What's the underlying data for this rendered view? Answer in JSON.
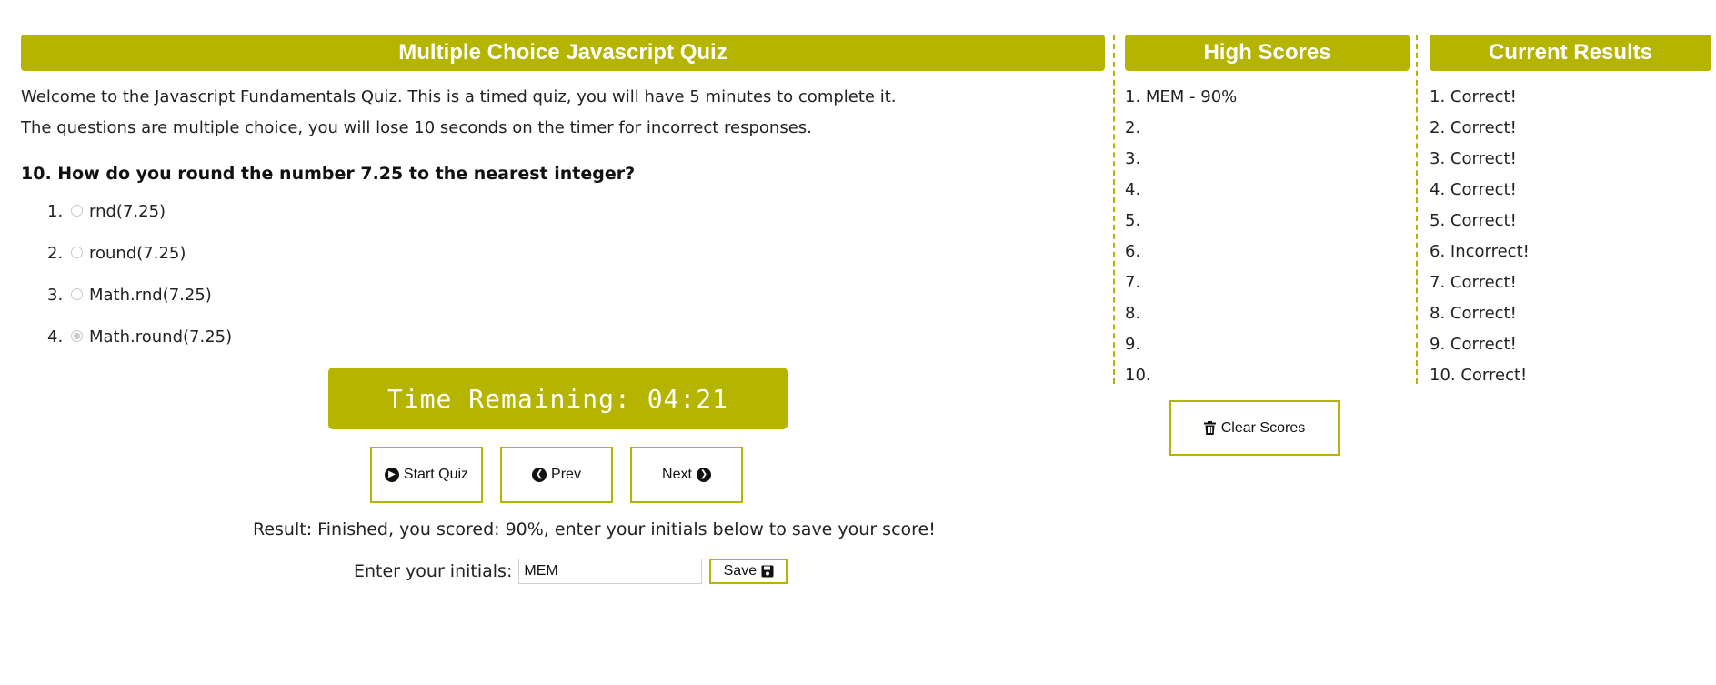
{
  "quiz": {
    "title": "Multiple Choice Javascript Quiz",
    "intro_line1": "Welcome to the Javascript Fundamentals Quiz. This is a timed quiz, you will have 5 minutes to complete it.",
    "intro_line2": "The questions are multiple choice, you will lose 10 seconds on the timer for incorrect responses.",
    "question": "10. How do you round the number 7.25 to the nearest integer?",
    "answers": [
      {
        "num": "1.",
        "label": "rnd(7.25)",
        "selected": false
      },
      {
        "num": "2.",
        "label": "round(7.25)",
        "selected": false
      },
      {
        "num": "3.",
        "label": "Math.rnd(7.25)",
        "selected": false
      },
      {
        "num": "4.",
        "label": "Math.round(7.25)",
        "selected": true
      }
    ],
    "timer_text": "Time Remaining: 04:21",
    "buttons": {
      "start": "Start Quiz",
      "prev": "Prev",
      "next": "Next"
    },
    "result_text": "Result: Finished, you scored: 90%, enter your initials below to save your score!",
    "initials_label": "Enter your initials:",
    "initials_value": "MEM",
    "save_label": "Save"
  },
  "high_scores": {
    "title": "High Scores",
    "items": [
      "1. MEM - 90%",
      "2.",
      "3.",
      "4.",
      "5.",
      "6.",
      "7.",
      "8.",
      "9.",
      "10."
    ],
    "clear_label": "Clear Scores"
  },
  "current_results": {
    "title": "Current Results",
    "items": [
      "1. Correct!",
      "2. Correct!",
      "3. Correct!",
      "4. Correct!",
      "5. Correct!",
      "6. Incorrect!",
      "7. Correct!",
      "8. Correct!",
      "9. Correct!",
      "10. Correct!"
    ]
  },
  "colors": {
    "accent": "#b5b400",
    "text": "#222222"
  },
  "icons": {
    "start": "play-circle-icon",
    "prev": "arrow-left-circle-icon",
    "next": "arrow-right-circle-icon",
    "save": "floppy-disk-icon",
    "clear": "trash-icon"
  }
}
